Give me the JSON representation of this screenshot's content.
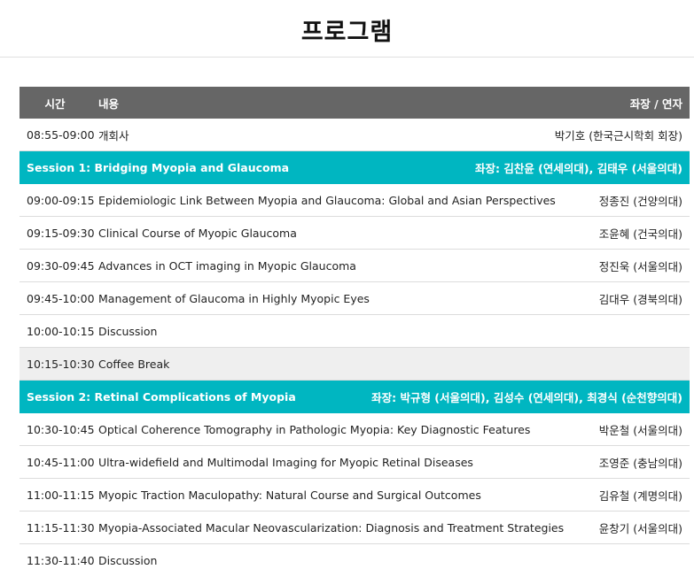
{
  "page": {
    "title": "프로그램"
  },
  "table": {
    "headers": {
      "time": "시간",
      "content": "내용",
      "speaker": "좌장 / 연자"
    },
    "opening": {
      "time": "08:55-09:00",
      "title": "개회사",
      "speaker": "박기호 (한국근시학회 회장)"
    },
    "session1": {
      "title": "Session 1: Bridging Myopia and Glaucoma",
      "chair": "좌장: 김찬윤 (연세의대), 김태우 (서울의대)",
      "rows": [
        {
          "time": "09:00-09:15",
          "title": "Epidemiologic Link Between Myopia and Glaucoma: Global and Asian Perspectives",
          "speaker": "정종진 (건양의대)"
        },
        {
          "time": "09:15-09:30",
          "title": "Clinical Course of Myopic Glaucoma",
          "speaker": "조윤혜 (건국의대)"
        },
        {
          "time": "09:30-09:45",
          "title": "Advances in OCT imaging in Myopic Glaucoma",
          "speaker": "정진욱 (서울의대)"
        },
        {
          "time": "09:45-10:00",
          "title": "Management of Glaucoma in Highly Myopic Eyes",
          "speaker": "김대우 (경북의대)"
        },
        {
          "time": "10:00-10:15",
          "title": "Discussion",
          "speaker": ""
        }
      ]
    },
    "coffee": {
      "time": "10:15-10:30",
      "title": "Coffee Break"
    },
    "session2": {
      "title": "Session 2: Retinal Complications of Myopia",
      "chair": "좌장: 박규형 (서울의대), 김성수 (연세의대), 최경식 (순천향의대)",
      "rows": [
        {
          "time": "10:30-10:45",
          "title": "Optical Coherence Tomography in Pathologic Myopia: Key Diagnostic Features",
          "speaker": "박운철 (서울의대)"
        },
        {
          "time": "10:45-11:00",
          "title": "Ultra-widefield and Multimodal Imaging for Myopic Retinal Diseases",
          "speaker": "조영준 (충남의대)"
        },
        {
          "time": "11:00-11:15",
          "title": "Myopic Traction Maculopathy: Natural Course and Surgical Outcomes",
          "speaker": "김유철 (계명의대)"
        },
        {
          "time": "11:15-11:30",
          "title": "Myopia-Associated Macular Neovascularization: Diagnosis and Treatment Strategies",
          "speaker": "윤창기 (서울의대)"
        },
        {
          "time": "11:30-11:40",
          "title": "Discussion",
          "speaker": ""
        }
      ]
    }
  }
}
